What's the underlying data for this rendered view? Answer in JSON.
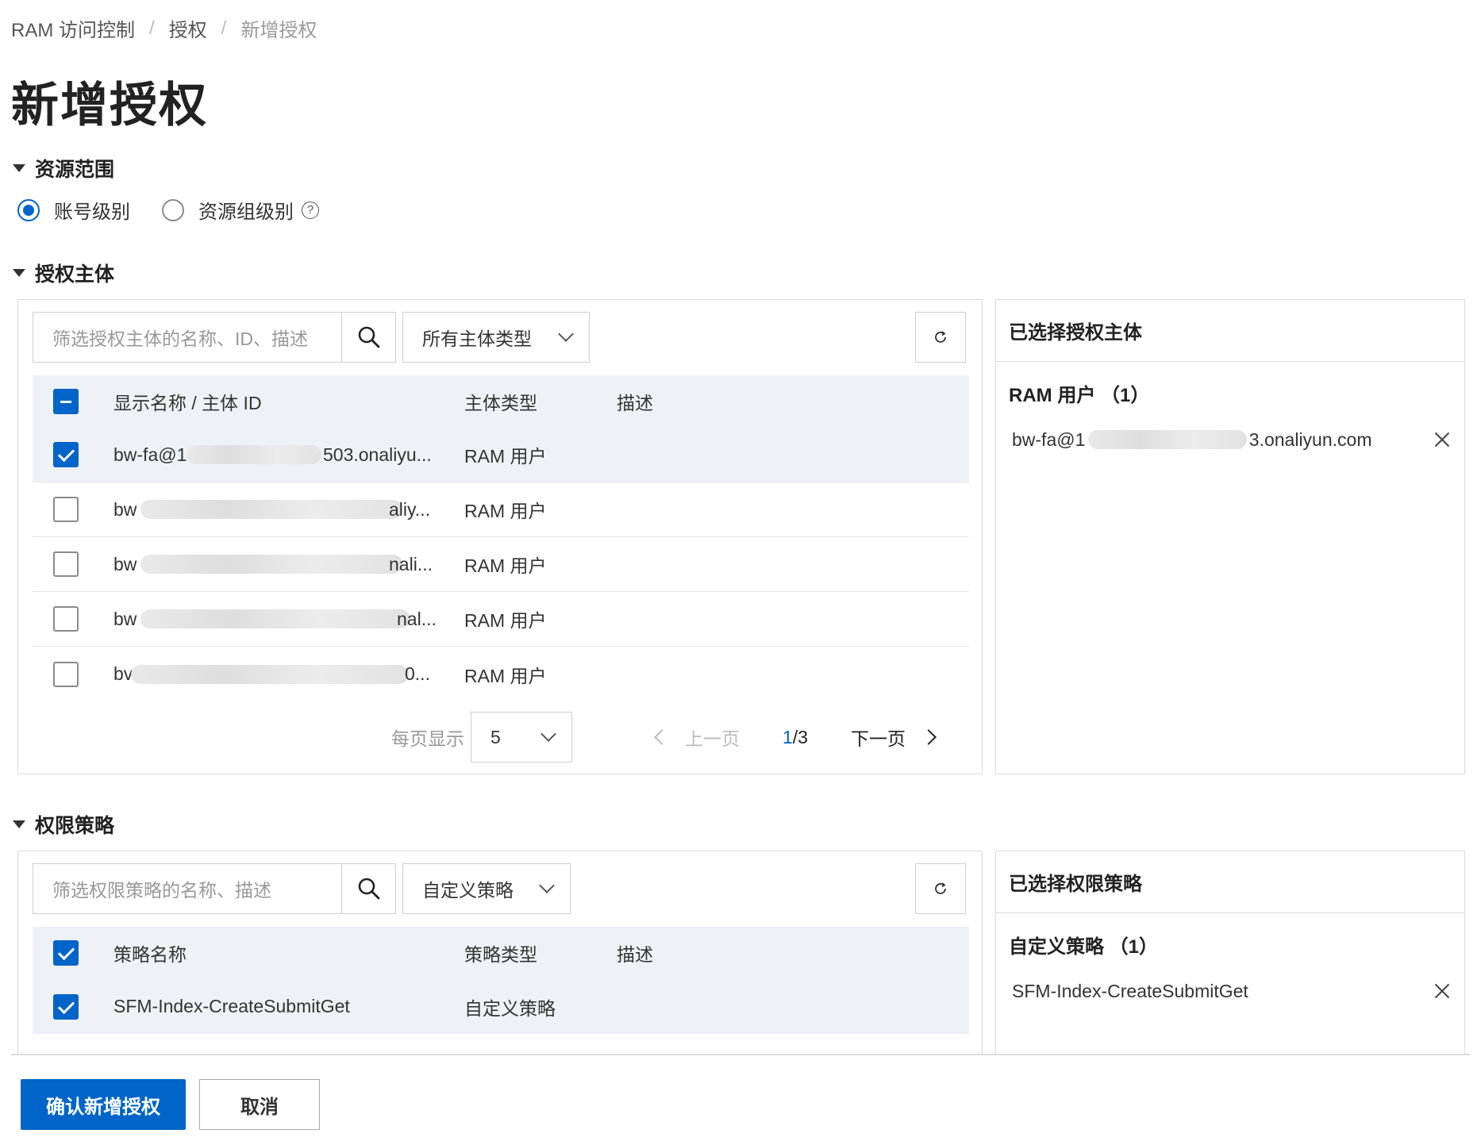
{
  "breadcrumb": [
    "RAM 访问控制",
    "授权",
    "新增授权"
  ],
  "page_title": "新增授权",
  "resource_scope": {
    "heading": "资源范围",
    "options": [
      {
        "label": "账号级别",
        "selected": true
      },
      {
        "label": "资源组级别",
        "selected": false
      }
    ],
    "help_icon": "?"
  },
  "principals": {
    "heading": "授权主体",
    "search_placeholder": "筛选授权主体的名称、ID、描述",
    "type_filter": "所有主体类型",
    "columns": [
      "显示名称 / 主体 ID",
      "主体类型",
      "描述"
    ],
    "rows": [
      {
        "name_prefix": "bw-fa@14",
        "name_suffix": "503.onaliyu...",
        "type": "RAM 用户",
        "checked": true
      },
      {
        "name_prefix": "bw",
        "name_suffix": "aliy...",
        "type": "RAM 用户",
        "checked": false
      },
      {
        "name_prefix": "bw",
        "name_suffix": "nali...",
        "type": "RAM 用户",
        "checked": false
      },
      {
        "name_prefix": "bw",
        "name_suffix": "nal...",
        "type": "RAM 用户",
        "checked": false
      },
      {
        "name_prefix": "bv",
        "name_suffix": "0...",
        "type": "RAM 用户",
        "checked": false
      }
    ],
    "pagination": {
      "page_size_label": "每页显示",
      "page_size": "5",
      "prev_label": "上一页",
      "current": "1",
      "total": "/3",
      "next_label": "下一页"
    }
  },
  "selected_principals": {
    "title": "已选择授权主体",
    "group_label": "RAM 用户 （1）",
    "item_prefix": "bw-fa@1",
    "item_suffix": "3.onaliyun.com"
  },
  "policies": {
    "heading": "权限策略",
    "search_placeholder": "筛选权限策略的名称、描述",
    "type_filter": "自定义策略",
    "columns": [
      "策略名称",
      "策略类型",
      "描述"
    ],
    "rows": [
      {
        "name": "SFM-Index-CreateSubmitGet",
        "type": "自定义策略",
        "checked": true
      }
    ]
  },
  "selected_policies": {
    "title": "已选择权限策略",
    "group_label": "自定义策略 （1）",
    "item": "SFM-Index-CreateSubmitGet"
  },
  "footer": {
    "confirm_label": "确认新增授权",
    "cancel_label": "取消"
  },
  "colors": {
    "primary": "#0064c8",
    "header_bg": "#eef1f5"
  }
}
